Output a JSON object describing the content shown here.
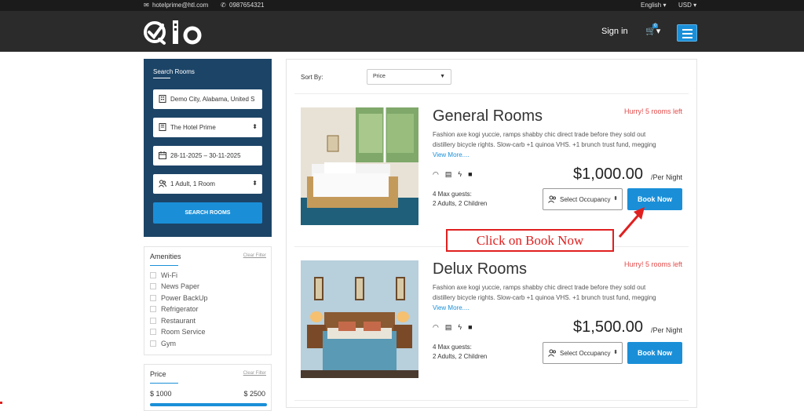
{
  "topbar": {
    "email": "hotelprime@htl.com",
    "phone": "0987654321",
    "language": "English",
    "currency": "USD"
  },
  "header": {
    "logo_text": "Qlo",
    "signin": "Sign in",
    "cart_count": "0"
  },
  "search": {
    "title": "Search Rooms",
    "location": "Demo City, Alabama, United S",
    "hotel": "The Hotel Prime",
    "dates": "28-11-2025  –  30-11-2025",
    "occupancy": "1 Adult, 1 Room",
    "button": "SEARCH ROOMS"
  },
  "amenities": {
    "title": "Amenities",
    "clear": "Clear Filter",
    "items": [
      "Wi-Fi",
      "News Paper",
      "Power BackUp",
      "Refrigerator",
      "Restaurant",
      "Room Service",
      "Gym"
    ]
  },
  "price_filter": {
    "title": "Price",
    "clear": "Clear Filter",
    "min": "$ 1000",
    "max": "$ 2500"
  },
  "sort": {
    "label": "Sort By:",
    "value": "Price"
  },
  "rooms": [
    {
      "name": "General Rooms",
      "hurry": "Hurry! 5 rooms left",
      "desc": "Fashion axe kogi yuccie, ramps shabby chic direct trade before they sold out distillery bicycle rights. Slow-carb +1 quinoa VHS. +1 brunch trust fund, megging",
      "more": "View More....",
      "price": "$1,000.00",
      "per_night": "/Per Night",
      "guests_line1": "4 Max guests:",
      "guests_line2": "2 Adults, 2 Children",
      "occupancy": "Select Occupancy",
      "book": "Book Now"
    },
    {
      "name": "Delux Rooms",
      "hurry": "Hurry! 5 rooms left",
      "desc": "Fashion axe kogi yuccie, ramps shabby chic direct trade before they sold out distillery bicycle rights. Slow-carb +1 quinoa VHS. +1 brunch trust fund, megging",
      "more": "View More....",
      "price": "$1,500.00",
      "per_night": "/Per Night",
      "guests_line1": "4 Max guests:",
      "guests_line2": "2 Adults, 2 Children",
      "occupancy": "Select Occupancy",
      "book": "Book Now"
    }
  ],
  "annotation": {
    "text": "Click on Book Now"
  },
  "colors": {
    "accent": "#1a8fd8",
    "sidebar": "#1c4467",
    "alert": "#e34a4a",
    "annotation": "#e02020"
  }
}
